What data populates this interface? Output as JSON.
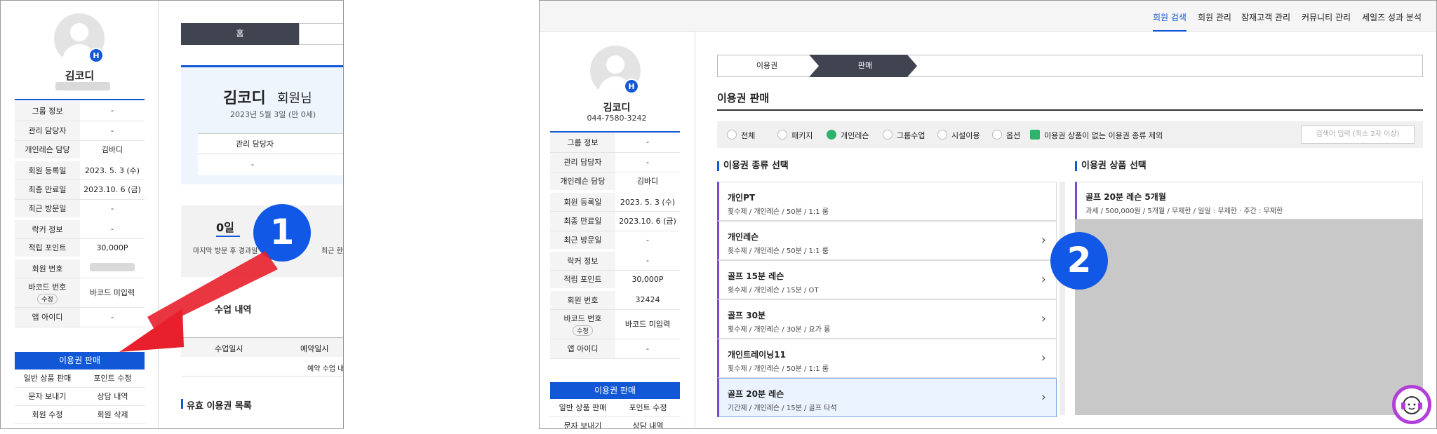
{
  "colors": {
    "accent": "#1157d6",
    "callout": "#1158e6",
    "arrow": "#e8202c",
    "check": "#2fb36a",
    "purple": "#7a4bd1"
  },
  "panel1": {
    "badge": "H",
    "member_name": "김코디",
    "info_rows": [
      {
        "k": "그룹 정보",
        "v": "-"
      },
      {
        "k": "관리 담당자",
        "v": "-"
      },
      {
        "k": "개인레슨 담당",
        "v": "김바디"
      },
      {
        "k": "회원 등록일",
        "v": "2023. 5. 3 (수)"
      },
      {
        "k": "최종 만료일",
        "v": "2023.10. 6 (금)"
      },
      {
        "k": "최근 방문일",
        "v": "-"
      },
      {
        "k": "락커 정보",
        "v": "-"
      },
      {
        "k": "적립 포인트",
        "v": "30,000P"
      },
      {
        "k": "회원 번호",
        "v": ""
      },
      {
        "k": "바코드 번호",
        "v": "바코드 미입력"
      },
      {
        "k": "앱 아이디",
        "v": "-"
      }
    ],
    "barcode_edit": "수정",
    "pass_sale_button": "이용권 판매",
    "menu": [
      "일반 상품 판매",
      "포인트 수정",
      "문자 보내기",
      "상담 내역",
      "회원 수정",
      "회원 삭제"
    ],
    "tab_home": "홈",
    "member_title": "김코디",
    "member_suffix": "회원님",
    "member_date": "2023년 5월 3일 (만 0세)",
    "manager_header": "관리 담당자",
    "manager_value": "-",
    "days_value": "0일",
    "days_caption": "마지막 방문 후 경과일",
    "recent_caption": "최근 한달",
    "class_history_title": "수업 내역",
    "class_cols": [
      "수업일시",
      "예약일시"
    ],
    "class_empty": "예약 수업 내",
    "valid_passes_title": "유효 이용권 목록",
    "callout": "1"
  },
  "panel2": {
    "nav": [
      "회원 검색",
      "회원 관리",
      "잠재고객 관리",
      "커뮤니티 관리",
      "세일즈 성과 분석"
    ],
    "badge": "H",
    "member_name": "김코디",
    "phone": "044-7580-3242",
    "info_rows": [
      {
        "k": "그룹 정보",
        "v": "-"
      },
      {
        "k": "관리 담당자",
        "v": "-"
      },
      {
        "k": "개인레슨 담당",
        "v": "김바디"
      },
      {
        "k": "회원 등록일",
        "v": "2023. 5. 3 (수)"
      },
      {
        "k": "최종 만료일",
        "v": "2023.10. 6 (금)"
      },
      {
        "k": "최근 방문일",
        "v": "-"
      },
      {
        "k": "락커 정보",
        "v": "-"
      },
      {
        "k": "적립 포인트",
        "v": "30,000P"
      },
      {
        "k": "회원 번호",
        "v": "32424"
      },
      {
        "k": "바코드 번호",
        "v": "바코드 미입력"
      },
      {
        "k": "앱 아이디",
        "v": "-"
      }
    ],
    "barcode_edit": "수정",
    "pass_sale_button": "이용권 판매",
    "menu": [
      "일반 상품 판매",
      "포인트 수정",
      "문자 보내기",
      "상담 내역"
    ],
    "steps": [
      "이용권",
      "판매"
    ],
    "page_title": "이용권 판매",
    "filters": [
      "전체",
      "패키지",
      "개인레슨",
      "그룹수업",
      "시설이용",
      "옵션"
    ],
    "exclude_label": "이용권 상품이 없는 이용권 종류 제외",
    "search_placeholder": "검색어 입력 (최소 2자 이상)",
    "type_title": "이용권 종류 선택",
    "product_title": "이용권 상품 선택",
    "types": [
      {
        "name": "개인PT",
        "desc": "횟수제 / 개인레슨 / 50분 / 1:1 룸"
      },
      {
        "name": "개인레슨",
        "desc": "횟수제 / 개인레슨 / 50분 / 1:1 룸"
      },
      {
        "name": "골프 15분 레슨",
        "desc": "횟수제 / 개인레슨 / 15분 / OT"
      },
      {
        "name": "골프 30분",
        "desc": "횟수제 / 개인레슨 / 30분 / 요가 룸"
      },
      {
        "name": "개인트레이닝11",
        "desc": "횟수제 / 개인레슨 / 50분 / 1:1 룸"
      },
      {
        "name": "골프 20분 레슨",
        "desc": "기간제 / 개인레슨 / 15분 / 골프 타석"
      }
    ],
    "product": {
      "name": "골프 20분 레슨 5개월",
      "desc": "과세 / 500,000원 / 5개월 / 무제한 / 일일 : 무제한 · 주간 : 무제한"
    },
    "callout": "2"
  }
}
